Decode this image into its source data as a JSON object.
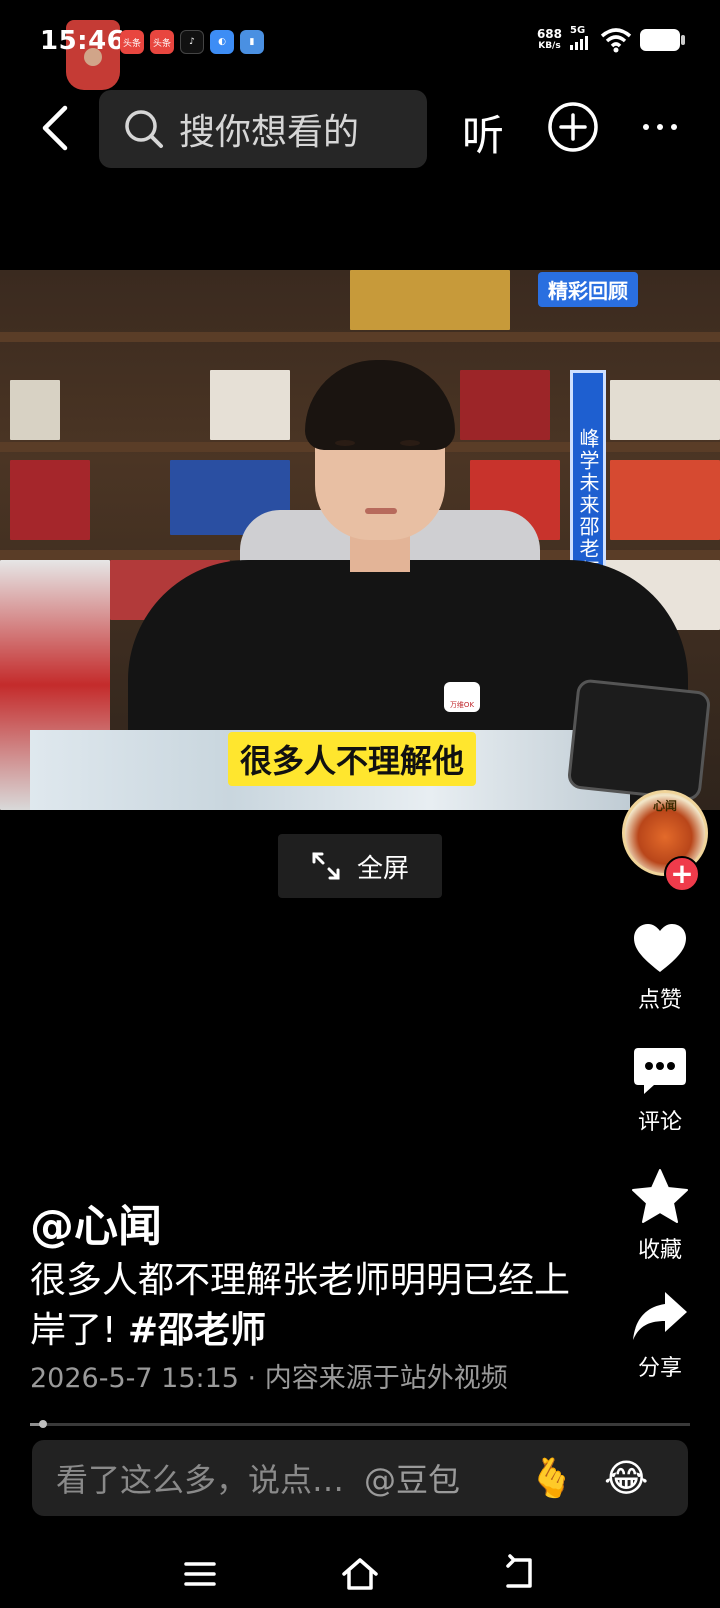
{
  "status_bar": {
    "time": "15:46",
    "net_speed_value": "688",
    "net_speed_unit": "KB/s",
    "net_type": "5G",
    "apps": [
      {
        "name": "toutiao-icon",
        "label": "头条",
        "color": "#e8463f"
      },
      {
        "name": "toutiao-icon",
        "label": "头条",
        "color": "#e8463f"
      },
      {
        "name": "tiktok-icon",
        "label": "",
        "color": "#111111"
      },
      {
        "name": "app-icon",
        "label": "",
        "color": "#3d8df5"
      },
      {
        "name": "app-icon",
        "label": "",
        "color": "#4a90e2"
      }
    ]
  },
  "top_nav": {
    "search_placeholder": "搜你想看的",
    "listen_label": "听"
  },
  "video": {
    "watermark": "精彩回顾",
    "banner_text": "峰学未来邵老师",
    "subtitle": "很多人不理解他",
    "chest_logo": "万维OK"
  },
  "fullscreen_label": "全屏",
  "rail": {
    "avatar_text": "心闻",
    "like_label": "点赞",
    "comment_label": "评论",
    "favorite_label": "收藏",
    "share_label": "分享"
  },
  "post": {
    "author": "@心闻",
    "caption_text": "很多人都不理解张老师明明已经上岸了! ",
    "hashtag": "#邵老师",
    "meta": "2026-5-7 15:15 · 内容来源于站外视频"
  },
  "progress": {
    "fraction": 0.02
  },
  "comment_bar": {
    "placeholder": "看了这么多，说点…",
    "mention": "@豆包",
    "emoji_1": "🫰",
    "emoji_2": "😂"
  },
  "colors": {
    "background": "#000000",
    "follow_red": "#ef3b4b",
    "subtitle_yellow": "#ffe62e"
  }
}
